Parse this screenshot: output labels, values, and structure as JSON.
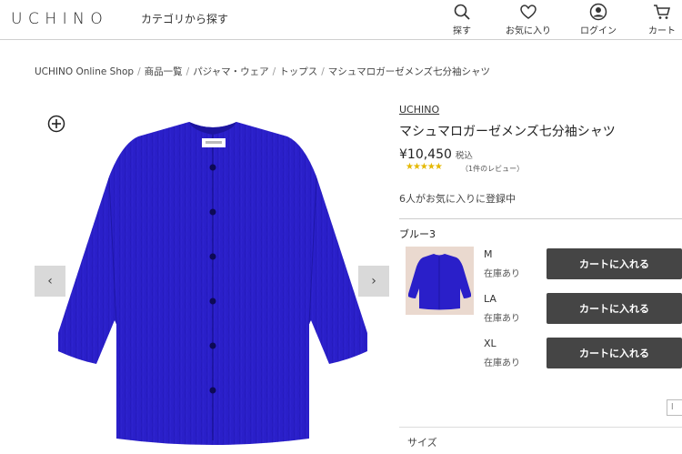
{
  "header": {
    "logo": "UCHINO",
    "category_link": "カテゴリから探す",
    "nav": [
      {
        "label": "探す",
        "icon": "search-icon"
      },
      {
        "label": "お気に入り",
        "icon": "heart-icon"
      },
      {
        "label": "ログイン",
        "icon": "user-icon"
      },
      {
        "label": "カート",
        "icon": "cart-icon"
      }
    ]
  },
  "breadcrumb": [
    "UCHINO Online Shop",
    "商品一覧",
    "パジャマ・ウェア",
    "トップス",
    "マシュマロガーゼメンズ七分袖シャツ"
  ],
  "gallery": {
    "prev": "‹",
    "next": "›",
    "product_color": "#2a1fc9"
  },
  "product": {
    "brand": "UCHINO",
    "name": "マシュマロガーゼメンズ七分袖シャツ",
    "price": "¥10,450",
    "tax_note": "税込",
    "rating": 5,
    "stars": "★★★★★",
    "reviews": "（1件のレビュー）",
    "favorites": "6人がお気に入りに登録中",
    "color_name": "ブルー3",
    "variants": [
      {
        "size": "M",
        "stock": "在庫あり",
        "button": "カートに入れる"
      },
      {
        "size": "LA",
        "stock": "在庫あり",
        "button": "カートに入れる"
      },
      {
        "size": "XL",
        "stock": "在庫あり",
        "button": "カートに入れる"
      }
    ],
    "side_box": "l",
    "size_section": "サイズ"
  }
}
